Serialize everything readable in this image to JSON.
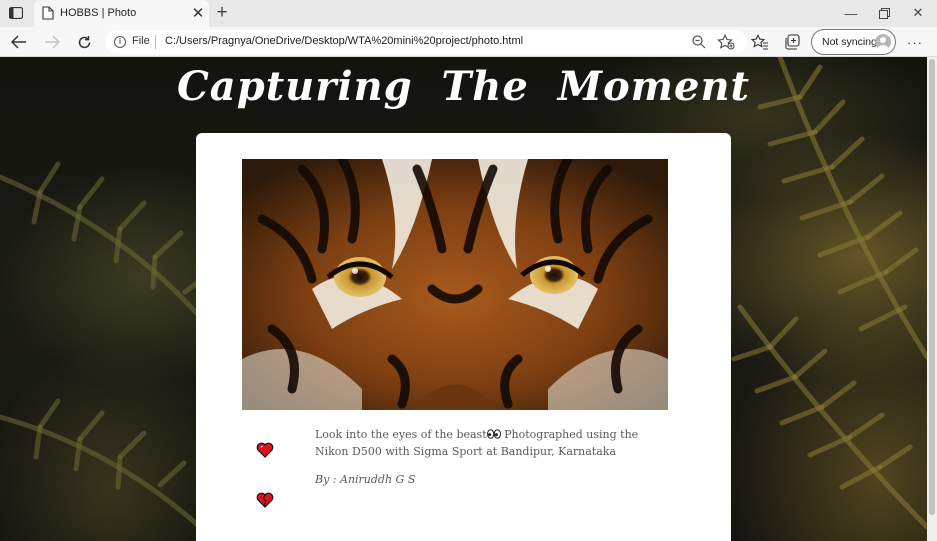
{
  "browser": {
    "tab_title": "HOBBS | Photo",
    "protocol_label": "File",
    "url": "C:/Users/Pragnya/OneDrive/Desktop/WTA%20mini%20project/photo.html",
    "sync_label": "Not syncing",
    "icons": [
      "window-menu-icon",
      "page-icon",
      "close-icon",
      "new-tab-icon",
      "minimize-icon",
      "restore-icon",
      "window-close-icon",
      "back-icon",
      "forward-icon",
      "refresh-icon",
      "info-icon",
      "zoom-out-icon",
      "add-favorite-icon",
      "favorites-icon",
      "collections-icon",
      "avatar-icon",
      "more-icon"
    ]
  },
  "page": {
    "title": "Capturing The Moment",
    "caption": "Look into the eyes of the beast",
    "caption_rest": " Photographed using the Nikon D500 with Sigma Sport at Bandipur, Karnataka",
    "credit": "By : Aniruddh G S",
    "like_icon": "heart-icon",
    "dislike_icon": "broken-heart-icon",
    "heart_color": "#e0101e"
  }
}
